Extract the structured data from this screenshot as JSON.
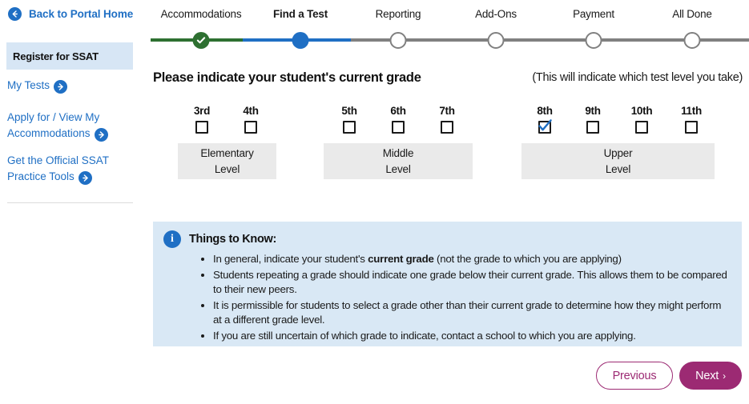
{
  "sidebar": {
    "back_link": {
      "label": "Back to Portal Home",
      "icon": "arrow-left-circle-icon"
    },
    "active_section": "Register for SSAT",
    "links": [
      {
        "label": "My Tests",
        "icon": "arrow-right-circle-icon"
      },
      {
        "label": "Apply for / View My Accommodations",
        "icon": "arrow-right-circle-icon"
      },
      {
        "label": "Get the Official SSAT Practice Tools",
        "icon": "arrow-right-circle-icon"
      }
    ]
  },
  "stepper": {
    "steps": [
      {
        "label": "Accommodations",
        "state": "done"
      },
      {
        "label": "Find a Test",
        "state": "current"
      },
      {
        "label": "Reporting",
        "state": "todo"
      },
      {
        "label": "Add-Ons",
        "state": "todo"
      },
      {
        "label": "Payment",
        "state": "todo"
      },
      {
        "label": "All Done",
        "state": "todo"
      }
    ],
    "colors": {
      "done": "#2e7031",
      "current": "#1f6fc4",
      "todo": "#808080"
    }
  },
  "main": {
    "heading": "Please indicate your student's current grade",
    "subnote": "(This will indicate which test level you take)",
    "grade_groups": [
      {
        "level_line1": "Elementary",
        "level_line2": "Level",
        "grades": [
          {
            "label": "3rd",
            "checked": false
          },
          {
            "label": "4th",
            "checked": false
          }
        ]
      },
      {
        "level_line1": "Middle",
        "level_line2": "Level",
        "grades": [
          {
            "label": "5th",
            "checked": false
          },
          {
            "label": "6th",
            "checked": false
          },
          {
            "label": "7th",
            "checked": false
          }
        ]
      },
      {
        "level_line1": "Upper",
        "level_line2": "Level",
        "grades": [
          {
            "label": "8th",
            "checked": true
          },
          {
            "label": "9th",
            "checked": false
          },
          {
            "label": "10th",
            "checked": false
          },
          {
            "label": "11th",
            "checked": false
          }
        ]
      }
    ]
  },
  "info_box": {
    "icon": "info-circle-icon",
    "title": "Things to Know:",
    "bullets": [
      {
        "before": "In general, indicate your student's ",
        "bold": "current grade",
        "after": " (not the grade to which you are applying)"
      },
      {
        "before": "Students repeating a grade should indicate one grade below their current grade. This allows them to be compared to their new peers.",
        "bold": "",
        "after": ""
      },
      {
        "before": "It is permissible for students to select a grade other than their current grade to determine how they might perform at a different grade level.",
        "bold": "",
        "after": ""
      },
      {
        "before": "If you are still uncertain of which grade to indicate, contact a school to which you are applying.",
        "bold": "",
        "after": ""
      }
    ]
  },
  "footer": {
    "previous_label": "Previous",
    "next_label": "Next",
    "next_chevron": "›",
    "accent_color": "#9c2a73"
  }
}
